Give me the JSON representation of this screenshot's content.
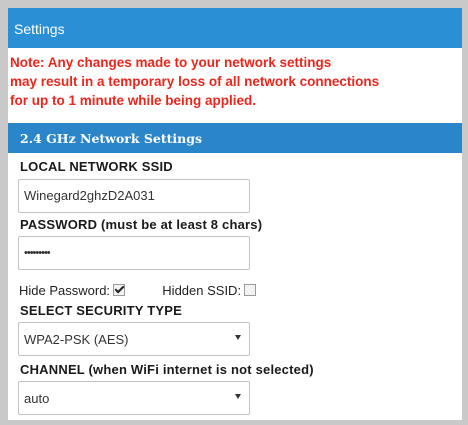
{
  "header": {
    "title": "Settings"
  },
  "note": {
    "line1": "Note: Any changes made to your network settings",
    "line2": "may result in a temporary loss of all network connections",
    "line3": "for up to 1 minute while being applied."
  },
  "section": {
    "title": "2.4 GHz Network Settings"
  },
  "ssid": {
    "label": "LOCAL NETWORK SSID",
    "value": "Winegard2ghzD2A031"
  },
  "password": {
    "label": "PASSWORD (must be at least 8 chars)",
    "value": "•••••••••"
  },
  "options": {
    "hide_password_label": "Hide Password:",
    "hide_password_checked": true,
    "hidden_ssid_label": "Hidden SSID:",
    "hidden_ssid_checked": false
  },
  "security": {
    "label": "SELECT SECURITY TYPE",
    "selected": "WPA2-PSK (AES)"
  },
  "channel": {
    "label": "CHANNEL (when WiFi internet is not selected)",
    "selected": "auto"
  },
  "colors": {
    "header_blue": "#2b8fd6",
    "section_blue": "#2a86c9",
    "note_red": "#e8281e"
  }
}
